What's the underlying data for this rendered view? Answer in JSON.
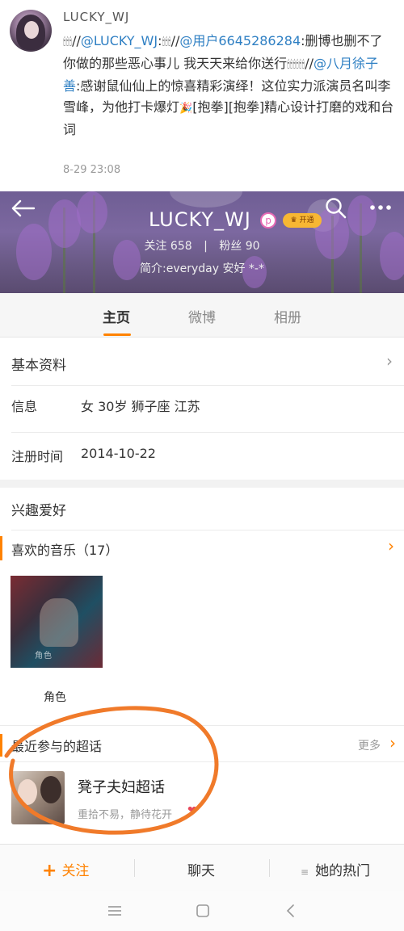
{
  "post": {
    "username": "LUCKY_WJ",
    "time": "8-29 23:08",
    "segments": [
      {
        "type": "emoji",
        "text": "🕯🕯🕯"
      },
      {
        "type": "text",
        "text": "//"
      },
      {
        "type": "link",
        "text": "@LUCKY_WJ"
      },
      {
        "type": "text",
        "text": ":"
      },
      {
        "type": "emoji",
        "text": "🕯🕯🕯"
      },
      {
        "type": "text",
        "text": "//"
      },
      {
        "type": "link",
        "text": "@用户6645286284"
      },
      {
        "type": "text",
        "text": ":删博也删不了你做的那些恶心事儿  我天天来给你送行"
      },
      {
        "type": "emoji",
        "text": "🕯🕯🕯🕯🕯🕯"
      },
      {
        "type": "text",
        "text": "//"
      },
      {
        "type": "link",
        "text": "@八月徐子善"
      },
      {
        "type": "text",
        "text": ":感谢鼠仙仙上的惊喜精彩演绎！这位实力派演员名叫李雪峰，为他打卡爆灯"
      },
      {
        "type": "emoji",
        "text": "🎉"
      },
      {
        "type": "text",
        "text": "[抱拳][抱拳]精心设计打磨的戏和台词"
      }
    ]
  },
  "profile": {
    "name": "LUCKY_WJ",
    "badge": "p",
    "vip_label": "开通",
    "following_label": "关注",
    "following_count": "658",
    "followers_label": "粉丝",
    "followers_count": "90",
    "bio": "简介:everyday 安好 *-*"
  },
  "tabs": [
    {
      "label": "主页",
      "active": true
    },
    {
      "label": "微博",
      "active": false
    },
    {
      "label": "相册",
      "active": false
    }
  ],
  "basic_info": {
    "title": "基本资料",
    "info_label": "信息",
    "info_value": "女  30岁  狮子座  江苏",
    "reg_label": "注册时间",
    "reg_value": "2014-10-22"
  },
  "interests": {
    "title": "兴趣爱好",
    "music_label": "喜欢的音乐（17）",
    "album_title": "角色",
    "album_text": "角色"
  },
  "super_topics": {
    "title": "最近参与的超话",
    "more": "更多",
    "topic_name": "凳子夫妇超话",
    "topic_sub": "重拾不易，静待花开",
    "heart": "❤"
  },
  "actions": {
    "follow": "关注",
    "chat": "聊天",
    "hot": "她的热门"
  },
  "colors": {
    "accent": "#ff8200",
    "link": "#2e7fc3",
    "annotation": "#f07a2a"
  }
}
